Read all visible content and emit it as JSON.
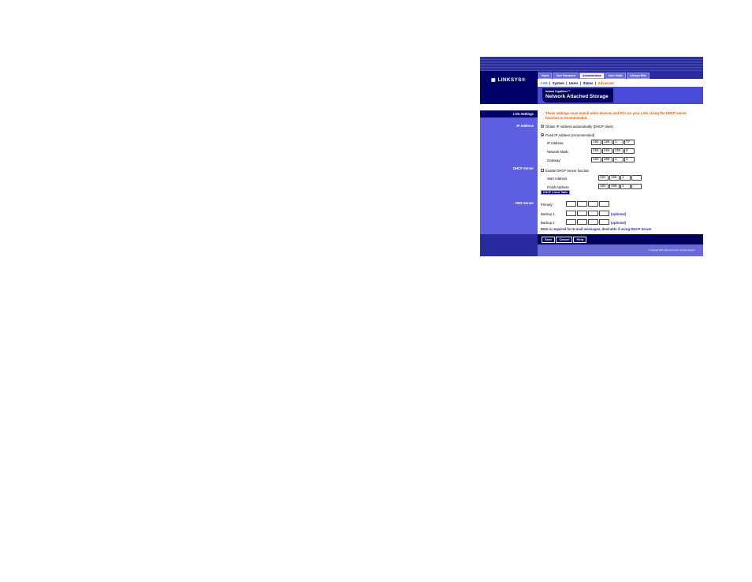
{
  "brand": {
    "logo": "LINKSYS",
    "logo_mark": "®"
  },
  "tabs": [
    "Home",
    "User Password",
    "Administration",
    "User Guide",
    "Linksys Web"
  ],
  "active_tab_index": 2,
  "subnav": {
    "items": [
      "LAN",
      "System",
      "Users",
      "Status"
    ],
    "advanced": "Advanced"
  },
  "product": {
    "small": "Instant GigaDrive™",
    "title": "Network Attached Storage"
  },
  "sections": {
    "lan_settings": "LAN Settings",
    "ip_address": "IP Address",
    "dhcp_server": "DHCP Server",
    "dns_server": "DNS Server"
  },
  "note": "These settings must match other devices and PCs on your LAN. Using the DHCP server function is recommended.",
  "ip": {
    "obtain_label": "Obtain IP Address automatically (DHCP client)",
    "fixed_label": "Fixed IP Address (recommended)",
    "fixed_selected": true,
    "ip_label": "IP Address:",
    "ip_value": [
      "192",
      "168",
      "1",
      "77"
    ],
    "mask_label": "Network Mask:",
    "mask_value": [
      "255",
      "255",
      "255",
      "0"
    ],
    "gateway_label": "Gateway:",
    "gateway_value": [
      "192",
      "168",
      "1",
      "1"
    ]
  },
  "dhcp": {
    "enable_label": "Enable DHCP Server function",
    "enabled": false,
    "start_label": "Start Address:",
    "start_value": [
      "192",
      "168",
      "1",
      ""
    ],
    "finish_label": "Finish Address:",
    "finish_value": [
      "192",
      "168",
      "1",
      ""
    ],
    "client_table_button": "DHCP Client Table"
  },
  "dns": {
    "primary_label": "Primary:",
    "backup1_label": "Backup 1:",
    "backup2_label": "Backup 2:",
    "optional": "(optional)",
    "note": "DNS is required for E-mail messages, desirable if using DHCP Server"
  },
  "buttons": {
    "save": "Save",
    "cancel": "Cancel",
    "help": "Help"
  },
  "copyright": "© Copyright 2001 Linksys Group Inc. All rights reserved.",
  "colors": {
    "header_navy": "#000066",
    "panel_blue": "#5e5ee0",
    "note_orange": "#e05a00",
    "link_blue": "#2a2ab0"
  }
}
